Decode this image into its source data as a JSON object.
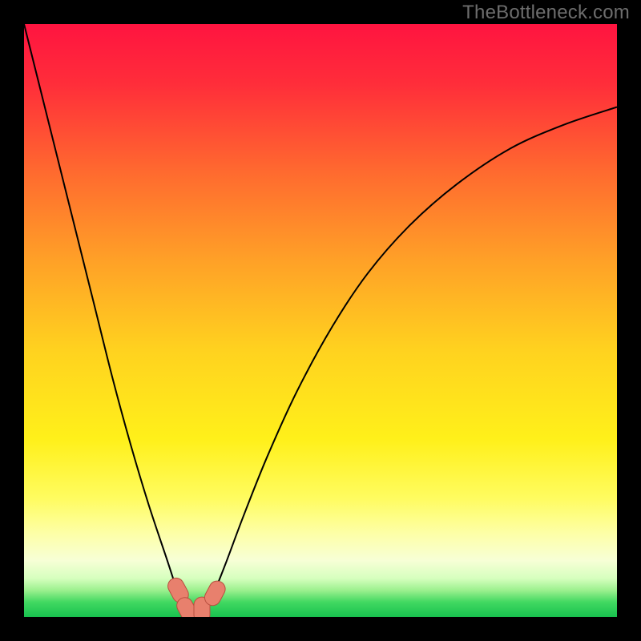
{
  "attribution": "TheBottleneck.com",
  "chart_data": {
    "type": "line",
    "title": "",
    "xlabel": "",
    "ylabel": "",
    "xlim": [
      0,
      100
    ],
    "ylim": [
      0,
      100
    ],
    "series": [
      {
        "name": "bottleneck-curve",
        "x": [
          0,
          3,
          6,
          9,
          12,
          15,
          18,
          21,
          24,
          26,
          27,
          28,
          29,
          30,
          31,
          32,
          34,
          37,
          41,
          46,
          52,
          58,
          65,
          73,
          82,
          91,
          100
        ],
        "values": [
          100,
          88,
          76,
          64,
          52,
          40,
          29,
          19,
          10,
          4,
          2,
          1,
          1,
          1,
          2,
          4,
          9,
          17,
          27,
          38,
          49,
          58,
          66,
          73,
          79,
          83,
          86
        ]
      }
    ],
    "markers": [
      {
        "name": "marker-a",
        "x": 26.0,
        "y": 4.5
      },
      {
        "name": "marker-b",
        "x": 27.5,
        "y": 1.2
      },
      {
        "name": "marker-c",
        "x": 30.0,
        "y": 1.2
      },
      {
        "name": "marker-d",
        "x": 32.2,
        "y": 4.0
      }
    ],
    "gradient_stops": [
      {
        "offset": 0.0,
        "color": "#ff1440"
      },
      {
        "offset": 0.1,
        "color": "#ff2d3a"
      },
      {
        "offset": 0.25,
        "color": "#ff6a2f"
      },
      {
        "offset": 0.4,
        "color": "#ffa127"
      },
      {
        "offset": 0.55,
        "color": "#ffd21f"
      },
      {
        "offset": 0.7,
        "color": "#fff01a"
      },
      {
        "offset": 0.8,
        "color": "#fffc60"
      },
      {
        "offset": 0.86,
        "color": "#fdffa8"
      },
      {
        "offset": 0.905,
        "color": "#f7ffd6"
      },
      {
        "offset": 0.935,
        "color": "#d6ffbe"
      },
      {
        "offset": 0.955,
        "color": "#9cf08e"
      },
      {
        "offset": 0.975,
        "color": "#41d861"
      },
      {
        "offset": 1.0,
        "color": "#18c24f"
      }
    ],
    "marker_style": {
      "fill": "#e8806d",
      "stroke": "#b84f3f"
    }
  }
}
